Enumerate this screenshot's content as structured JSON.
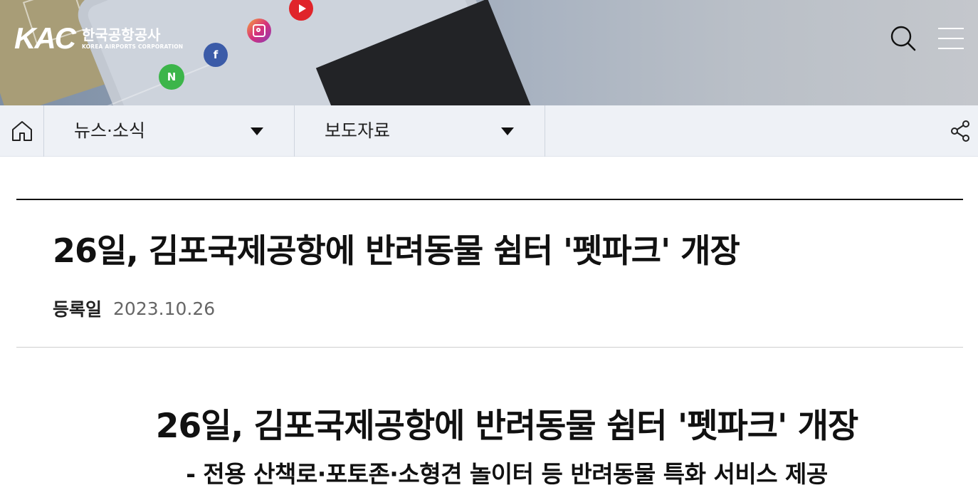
{
  "header": {
    "logo": {
      "mark": "KAC",
      "name_ko": "한국공항공사",
      "name_en": "KOREA AIRPORTS CORPORATION"
    },
    "banner_apps": [
      {
        "icon": "naver-icon",
        "letter": "N",
        "color": "#3cb54a"
      },
      {
        "icon": "facebook-icon",
        "letter": "f",
        "color": "#3b5ba8"
      },
      {
        "icon": "instagram-icon",
        "letter": "",
        "color": "#d6307a"
      },
      {
        "icon": "youtube-icon",
        "letter": "",
        "color": "#e0242a"
      }
    ],
    "search_icon": "search-icon",
    "menu_icon": "hamburger-menu-icon"
  },
  "breadcrumb": {
    "home_icon": "home-icon",
    "level1": "뉴스·소식",
    "level2": "보도자료",
    "share_icon": "share-icon"
  },
  "post": {
    "title": "26일, 김포국제공항에 반려동물 쉼터 '펫파크' 개장",
    "meta_label": "등록일",
    "date": "2023.10.26"
  },
  "body": {
    "title": "26일, 김포국제공항에 반려동물 쉼터 '펫파크' 개장",
    "subtitle": "- 전용 산책로·포토존·소형견 놀이터 등 반려동물 특화 서비스 제공"
  },
  "colors": {
    "breadcrumb_bg": "#eef1f6",
    "text_primary": "#111111",
    "text_meta": "#666666"
  }
}
